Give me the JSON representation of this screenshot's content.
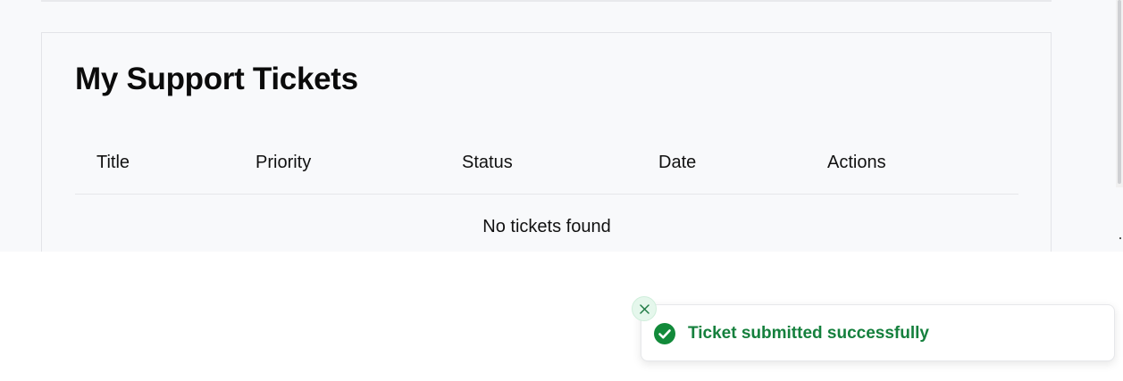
{
  "page": {
    "title": "My Support Tickets"
  },
  "table": {
    "columns": [
      "Title",
      "Priority",
      "Status",
      "Date",
      "Actions"
    ],
    "empty_message": "No tickets found"
  },
  "toast": {
    "message": "Ticket submitted successfully",
    "type": "success",
    "icon": "check-circle-icon",
    "close_icon": "close-icon"
  },
  "colors": {
    "success_text": "#15803d",
    "success_icon": "#128a3a",
    "page_background": "#f8f9fb"
  }
}
